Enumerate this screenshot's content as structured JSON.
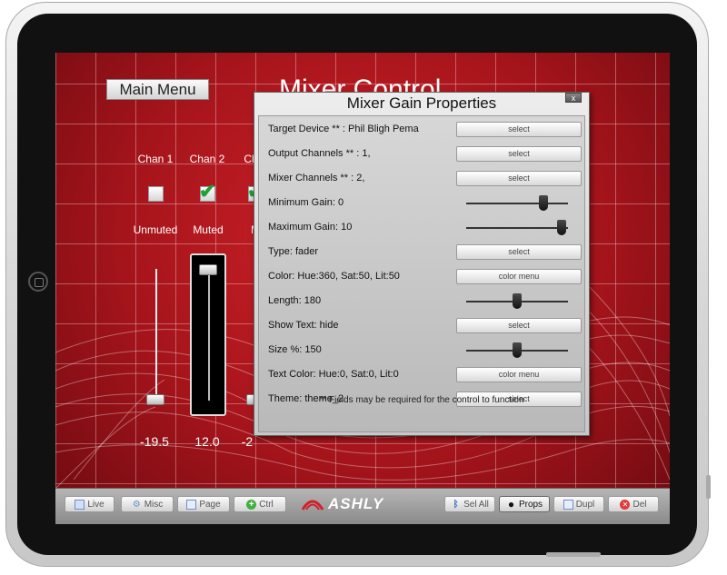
{
  "screen": {
    "main_menu_label": "Main Menu",
    "title": "Mixer Control"
  },
  "channels": [
    {
      "label": "Chan 1",
      "checked": false,
      "mute_label": "Unmuted",
      "value": "-19.5",
      "fader_level": 0.05
    },
    {
      "label": "Chan 2",
      "checked": true,
      "mute_label": "Muted",
      "value": "12.0",
      "fader_level": 1.0
    },
    {
      "label": "Ch",
      "checked": true,
      "mute_label": "M",
      "value": "-2",
      "fader_level": 0.05
    }
  ],
  "dialog": {
    "title": "Mixer Gain Properties",
    "close_label": "x",
    "rows": [
      {
        "label": "Target Device ** :  Phil Bligh Pema",
        "control": "button",
        "button_label": "select"
      },
      {
        "label": "Output Channels ** :  1,",
        "control": "button",
        "button_label": "select"
      },
      {
        "label": "Mixer Channels ** :  2,",
        "control": "button",
        "button_label": "select"
      },
      {
        "label": "Minimum Gain:  0",
        "control": "slider",
        "level": 0.78
      },
      {
        "label": "Maximum Gain:  10",
        "control": "slider",
        "level": 0.98
      },
      {
        "label": "Type:  fader",
        "control": "button",
        "button_label": "select"
      },
      {
        "label": "Color:  Hue:360, Sat:50, Lit:50",
        "control": "button",
        "button_label": "color menu"
      },
      {
        "label": "Length:  180",
        "control": "slider",
        "level": 0.5
      },
      {
        "label": "Show Text:  hide",
        "control": "button",
        "button_label": "select"
      },
      {
        "label": "Size %:  150",
        "control": "slider",
        "level": 0.5
      },
      {
        "label": "Text Color:  Hue:0, Sat:0, Lit:0",
        "control": "button",
        "button_label": "color menu"
      },
      {
        "label": "Theme:  theme_2",
        "control": "button",
        "button_label": "select"
      }
    ],
    "footer_note": "** Fields may be required for the control to function"
  },
  "toolbar": {
    "brand": "ASHLY",
    "buttons": [
      {
        "label": "Live",
        "icon": "window-icon",
        "active": false
      },
      {
        "label": "Misc",
        "icon": "gear-icon",
        "active": false
      },
      {
        "label": "Page",
        "icon": "pages-icon",
        "active": false
      },
      {
        "label": "Ctrl",
        "icon": "plus-icon",
        "active": false
      },
      {
        "label": "Sel All",
        "icon": "bluetooth-icon",
        "active": false
      },
      {
        "label": "Props",
        "icon": "dot-icon",
        "active": true
      },
      {
        "label": "Dupl",
        "icon": "duplicate-icon",
        "active": false
      },
      {
        "label": "Del",
        "icon": "delete-icon",
        "active": false
      }
    ]
  },
  "colors": {
    "background_red": "#a5141b",
    "check_green": "#1ea032",
    "brand_red": "#d0202a"
  }
}
